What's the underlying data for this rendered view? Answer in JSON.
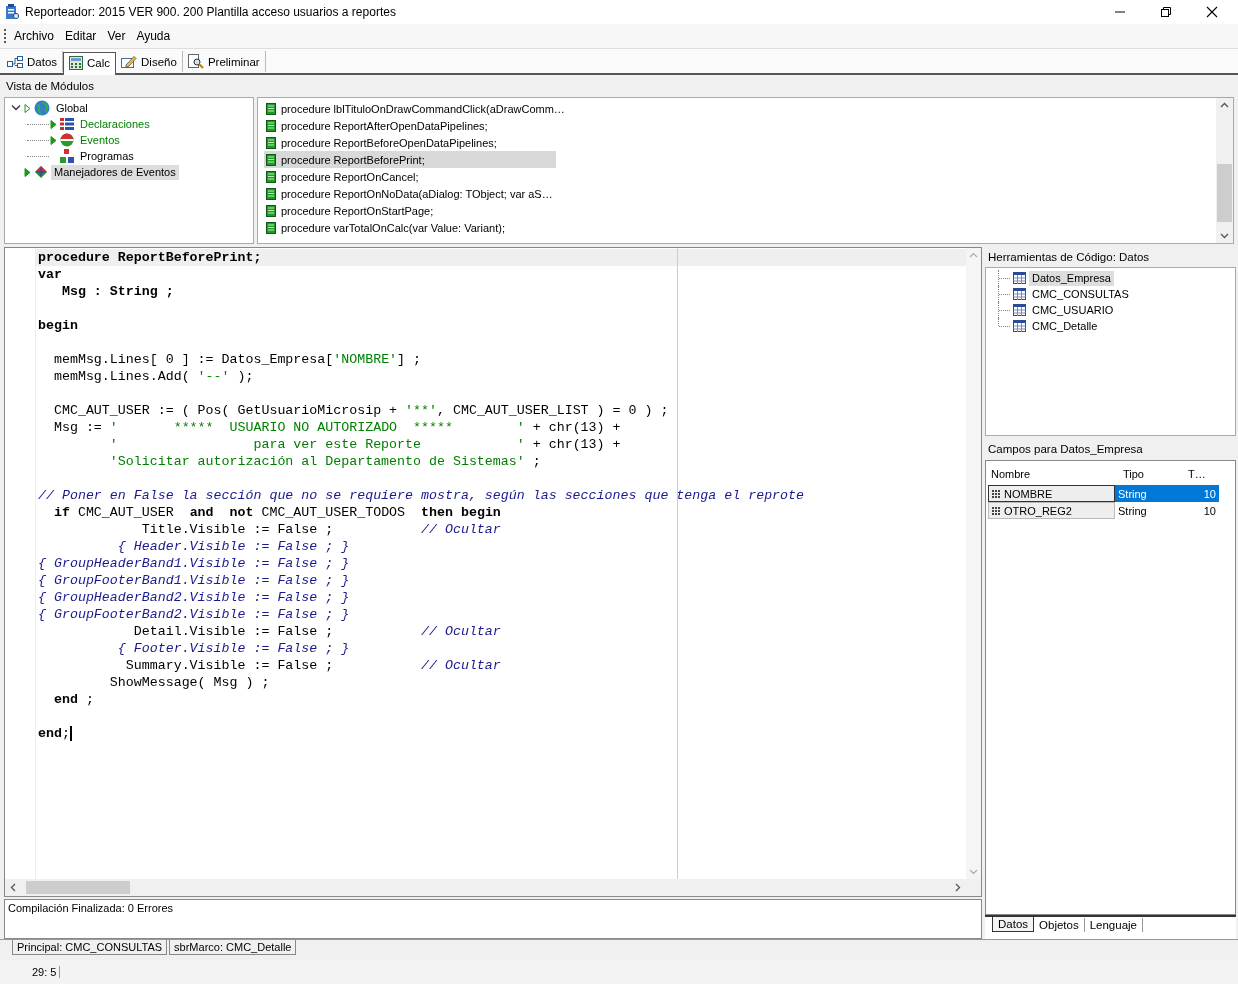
{
  "window": {
    "title": "Reporteador: 2015 VER 900. 200 Plantilla acceso usuarios a reportes"
  },
  "menu": [
    "Archivo",
    "Editar",
    "Ver",
    "Ayuda"
  ],
  "tabs": [
    {
      "label": "Datos",
      "kind": "datos",
      "selected": false
    },
    {
      "label": "Calc",
      "kind": "calc",
      "selected": true
    },
    {
      "label": "Diseño",
      "kind": "diseno",
      "selected": false
    },
    {
      "label": "Preliminar",
      "kind": "preliminar",
      "selected": false
    }
  ],
  "modules": {
    "title": "Vista de Módulos",
    "tree": [
      {
        "label": "Global",
        "kind": "globe",
        "active": false,
        "selected": false,
        "expanded": true,
        "children": [
          {
            "label": "Declaraciones",
            "kind": "declaraciones",
            "active": true,
            "selected": false,
            "expanded": false
          },
          {
            "label": "Eventos",
            "kind": "eventos",
            "active": true,
            "selected": false,
            "expanded": false
          },
          {
            "label": "Programas",
            "kind": "programas",
            "active": false,
            "selected": false
          }
        ]
      },
      {
        "label": "Manejadores de Eventos",
        "kind": "manejadores",
        "active": false,
        "selected": true,
        "expanded": false
      }
    ],
    "procedures": [
      {
        "label": "procedure lblTituloOnDrawCommandClick(aDrawComm…",
        "selected": false
      },
      {
        "label": "procedure ReportAfterOpenDataPipelines;",
        "selected": false
      },
      {
        "label": "procedure ReportBeforeOpenDataPipelines;",
        "selected": false
      },
      {
        "label": "procedure ReportBeforePrint;",
        "selected": true
      },
      {
        "label": "procedure ReportOnCancel;",
        "selected": false
      },
      {
        "label": "procedure ReportOnNoData(aDialog: TObject; var aS…",
        "selected": false
      },
      {
        "label": "procedure ReportOnStartPage;",
        "selected": false
      },
      {
        "label": "procedure varTotalOnCalc(var Value: Variant);",
        "selected": false
      }
    ]
  },
  "editor": {
    "lines": [
      {
        "highlighted": true,
        "segments": [
          {
            "text": "procedure ReportBeforePrint;",
            "kind": "keyword"
          }
        ]
      },
      {
        "highlighted": false,
        "segments": [
          {
            "text": "var",
            "kind": "keyword"
          }
        ]
      },
      {
        "highlighted": false,
        "segments": [
          {
            "text": "   Msg : String ;",
            "kind": "keyword"
          }
        ]
      },
      {
        "highlighted": false
      },
      {
        "highlighted": false,
        "segments": [
          {
            "text": "begin",
            "kind": "keyword"
          }
        ]
      },
      {
        "highlighted": false
      },
      {
        "highlighted": false,
        "segments": [
          {
            "text": "  memMsg.Lines[ 0 ] := Datos_Empresa[",
            "kind": "text"
          },
          {
            "text": "'NOMBRE'",
            "kind": "string"
          },
          {
            "text": "] ;",
            "kind": "text"
          }
        ]
      },
      {
        "highlighted": false,
        "segments": [
          {
            "text": "  memMsg.Lines.Add( ",
            "kind": "text"
          },
          {
            "text": "'--'",
            "kind": "string"
          },
          {
            "text": " );",
            "kind": "text"
          }
        ]
      },
      {
        "highlighted": false
      },
      {
        "highlighted": false,
        "segments": [
          {
            "text": "  CMC_AUT_USER := ( Pos( GetUsuarioMicrosip + ",
            "kind": "text"
          },
          {
            "text": "'**'",
            "kind": "string"
          },
          {
            "text": ", CMC_AUT_USER_LIST ) = 0 ) ;",
            "kind": "text"
          }
        ]
      },
      {
        "highlighted": false,
        "segments": [
          {
            "text": "  Msg := ",
            "kind": "text"
          },
          {
            "text": "'       *****  USUARIO NO AUTORIZADO  *****        '",
            "kind": "string"
          },
          {
            "text": " + chr(13) +",
            "kind": "text"
          }
        ]
      },
      {
        "highlighted": false,
        "segments": [
          {
            "text": "         '                 para ver este Reporte            '",
            "kind": "string"
          },
          {
            "text": " + chr(13) +",
            "kind": "text"
          }
        ]
      },
      {
        "highlighted": false,
        "segments": [
          {
            "text": "         'Solicitar autorización al Departamento de Sistemas'",
            "kind": "string"
          },
          {
            "text": " ;",
            "kind": "text"
          }
        ]
      },
      {
        "highlighted": false
      },
      {
        "highlighted": false,
        "segments": [
          {
            "text": "// Poner en False la sección que no se requiere mostra, según las secciones que tenga el reprote",
            "kind": "comment"
          }
        ]
      },
      {
        "highlighted": false,
        "segments": [
          {
            "text": "  if",
            "kind": "keyword"
          },
          {
            "text": " CMC_AUT_USER  ",
            "kind": "text"
          },
          {
            "text": "and  not",
            "kind": "keyword"
          },
          {
            "text": " CMC_AUT_USER_TODOS  ",
            "kind": "text"
          },
          {
            "text": "then begin",
            "kind": "keyword"
          }
        ]
      },
      {
        "highlighted": false,
        "segments": [
          {
            "text": "             Title.Visible := False ;           ",
            "kind": "text"
          },
          {
            "text": "// Ocultar",
            "kind": "comment"
          }
        ]
      },
      {
        "highlighted": false,
        "segments": [
          {
            "text": "          { Header.Visible := False ; }",
            "kind": "comment"
          }
        ]
      },
      {
        "highlighted": false,
        "segments": [
          {
            "text": "{ GroupHeaderBand1.Visible := False ; }",
            "kind": "comment"
          }
        ]
      },
      {
        "highlighted": false,
        "segments": [
          {
            "text": "{ GroupFooterBand1.Visible := False ; }",
            "kind": "comment"
          }
        ]
      },
      {
        "highlighted": false,
        "segments": [
          {
            "text": "{ GroupHeaderBand2.Visible := False ; }",
            "kind": "comment"
          }
        ]
      },
      {
        "highlighted": false,
        "segments": [
          {
            "text": "{ GroupFooterBand2.Visible := False ; }",
            "kind": "comment"
          }
        ]
      },
      {
        "highlighted": false,
        "segments": [
          {
            "text": "            Detail.Visible := False ;           ",
            "kind": "text"
          },
          {
            "text": "// Ocultar",
            "kind": "comment"
          }
        ]
      },
      {
        "highlighted": false,
        "segments": [
          {
            "text": "          { Footer.Visible := False ; }",
            "kind": "comment"
          }
        ]
      },
      {
        "highlighted": false,
        "segments": [
          {
            "text": "           Summary.Visible := False ;           ",
            "kind": "text"
          },
          {
            "text": "// Ocultar",
            "kind": "comment"
          }
        ]
      },
      {
        "highlighted": false,
        "segments": [
          {
            "text": "         ShowMessage( Msg ) ;",
            "kind": "text"
          }
        ]
      },
      {
        "highlighted": false,
        "segments": [
          {
            "text": "  end",
            "kind": "keyword"
          },
          {
            "text": " ;",
            "kind": "text"
          }
        ]
      },
      {
        "highlighted": false
      },
      {
        "highlighted": false,
        "caret": true,
        "segments": [
          {
            "text": "end",
            "kind": "keyword"
          },
          {
            "text": ";",
            "kind": "text"
          }
        ]
      }
    ]
  },
  "messages": [
    "Compilación Finalizada: 0 Errores"
  ],
  "tools": {
    "title": "Herramientas de Código: Datos",
    "tables": [
      {
        "label": "Datos_Empresa",
        "selected": true
      },
      {
        "label": "CMC_CONSULTAS",
        "selected": false
      },
      {
        "label": "CMC_USUARIO",
        "selected": false
      },
      {
        "label": "CMC_Detalle",
        "selected": false
      }
    ],
    "fields_title": "Campos para Datos_Empresa",
    "columns": [
      "Nombre",
      "Tipo",
      "T…"
    ],
    "rows": [
      {
        "cells": [
          "NOMBRE",
          "String",
          "10"
        ],
        "selected": true
      },
      {
        "cells": [
          "OTRO_REG2",
          "String",
          "10"
        ],
        "selected": false
      }
    ],
    "tabs": [
      {
        "label": "Datos",
        "selected": true
      },
      {
        "label": "Objetos",
        "selected": false
      },
      {
        "label": "Lenguaje",
        "selected": false
      }
    ]
  },
  "bottom_tabs": [
    "Principal: CMC_CONSULTAS",
    "sbrMarco: CMC_Detalle"
  ],
  "status_bar": {
    "position": "29: 5"
  }
}
